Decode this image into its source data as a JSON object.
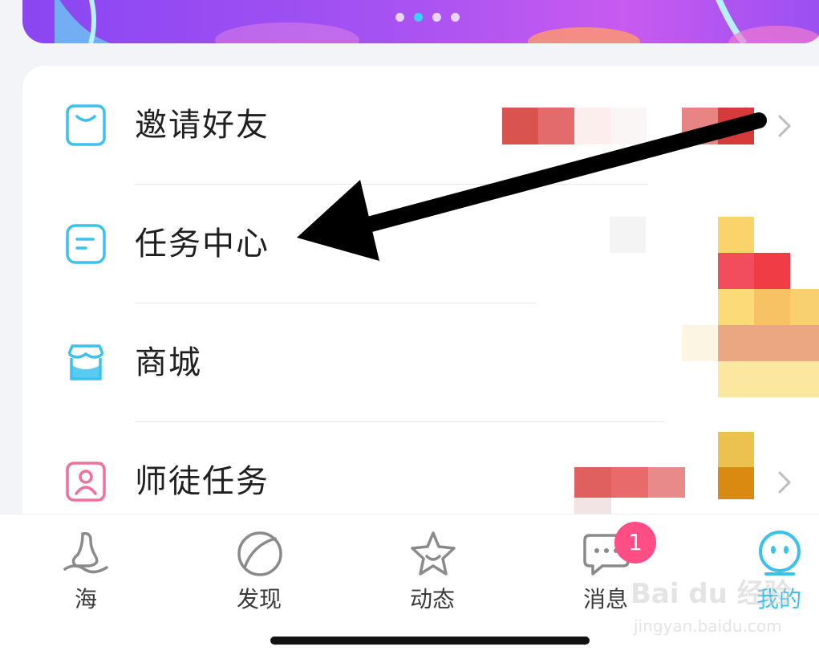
{
  "banner": {
    "page_count": 4,
    "active_index": 1
  },
  "menu": {
    "items": [
      {
        "label": "邀请好友",
        "icon": "invite-icon",
        "has_chevron": true
      },
      {
        "label": "任务中心",
        "icon": "task-center-icon",
        "has_chevron": false
      },
      {
        "label": "商城",
        "icon": "shop-icon",
        "has_chevron": false
      },
      {
        "label": "师徒任务",
        "icon": "mentor-icon",
        "has_chevron": true
      }
    ]
  },
  "tabbar": {
    "tabs": [
      {
        "label": "海",
        "icon": "sea-icon"
      },
      {
        "label": "发现",
        "icon": "discover-icon"
      },
      {
        "label": "动态",
        "icon": "feed-star-icon"
      },
      {
        "label": "消息",
        "icon": "message-icon"
      },
      {
        "label": "我的",
        "icon": "profile-icon"
      }
    ],
    "active_index": 4,
    "message_badge": "1"
  },
  "watermark": {
    "main": "Bai du 经验",
    "sub": "jingyan.baidu.com"
  },
  "colors": {
    "accent": "#3cc1ee",
    "badge": "#ff4d86",
    "banner": "#a552f2",
    "mentor_icon": "#f0709a"
  }
}
